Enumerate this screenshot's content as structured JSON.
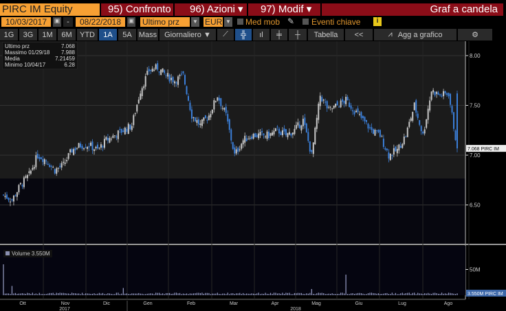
{
  "header": {
    "ticker": "PIRC IM Equity",
    "compare": "95) Confronto",
    "actions": "96) Azioni",
    "modify": "97) Modif",
    "title": "Graf a candela"
  },
  "controls": {
    "start_date": "10/03/2017",
    "dash": "-",
    "end_date": "08/22/2018",
    "field": "Ultimo prz",
    "currency": "EUR",
    "moving_avg": "Med mob",
    "key_events": "Eventi chiave",
    "info": "i"
  },
  "periods": [
    {
      "label": "1G"
    },
    {
      "label": "3G"
    },
    {
      "label": "1M"
    },
    {
      "label": "6M"
    },
    {
      "label": "YTD"
    },
    {
      "label": "1A",
      "selected": true
    },
    {
      "label": "5A"
    },
    {
      "label": "Mass"
    }
  ],
  "toolbar": {
    "frequency": "Giornaliero ▼",
    "table": "Tabella",
    "collapse": "<<",
    "add_chart": "Agg a grafico"
  },
  "legend": {
    "rows": [
      {
        "label": "Ultimo prz",
        "value": "7.068"
      },
      {
        "label": "Massimo 01/29/18",
        "value": "7.988"
      },
      {
        "label": "Media",
        "value": "7.21459"
      },
      {
        "label": "Minimo 10/04/17",
        "value": "6.28"
      }
    ]
  },
  "volume_legend": "Volume 3.550M",
  "colors": {
    "up": "#c8c8c8",
    "down": "#3b7fd9",
    "orange": "#f7a033",
    "red": "#8b0d18"
  },
  "chart_data": {
    "type": "candlestick",
    "y_ticks": [
      {
        "v": 8.0,
        "label": "8.00"
      },
      {
        "v": 7.5,
        "label": "7.50"
      },
      {
        "v": 7.0,
        "label": "7.00"
      },
      {
        "v": 6.5,
        "label": "6.50"
      }
    ],
    "last_label": "7.068 PIRC IM",
    "volume_ticks": [
      {
        "v": 50,
        "label": "50M"
      }
    ],
    "volume_last_label": "3.550M PIRC IM",
    "months": [
      "Ott",
      "Nov",
      "Dic",
      "Gen",
      "Feb",
      "Mar",
      "Apr",
      "Mag",
      "Giu",
      "Lug",
      "Ago"
    ],
    "years": [
      "2017",
      "2018"
    ],
    "weekly_closes": [
      6.6,
      6.55,
      6.7,
      6.8,
      7.0,
      6.95,
      6.85,
      6.9,
      7.05,
      7.1,
      7.1,
      7.05,
      7.15,
      7.2,
      7.25,
      7.3,
      7.65,
      7.85,
      7.88,
      7.8,
      7.75,
      7.8,
      7.4,
      7.3,
      7.4,
      7.6,
      7.4,
      7.0,
      7.15,
      7.2,
      7.2,
      7.2,
      7.25,
      7.2,
      7.25,
      7.35,
      7.0,
      7.6,
      7.45,
      7.5,
      7.55,
      7.45,
      7.35,
      7.25,
      7.2,
      7.0,
      7.05,
      7.2,
      7.5,
      7.2,
      7.65,
      7.6,
      7.62,
      7.068
    ],
    "volume_spikes": [
      {
        "week": 0,
        "v": 60
      },
      {
        "week": 1,
        "v": 18
      },
      {
        "week": 14,
        "v": 14
      },
      {
        "week": 36,
        "v": 12
      },
      {
        "week": 40,
        "v": 40
      }
    ],
    "ylim": [
      6.1,
      8.2
    ]
  }
}
